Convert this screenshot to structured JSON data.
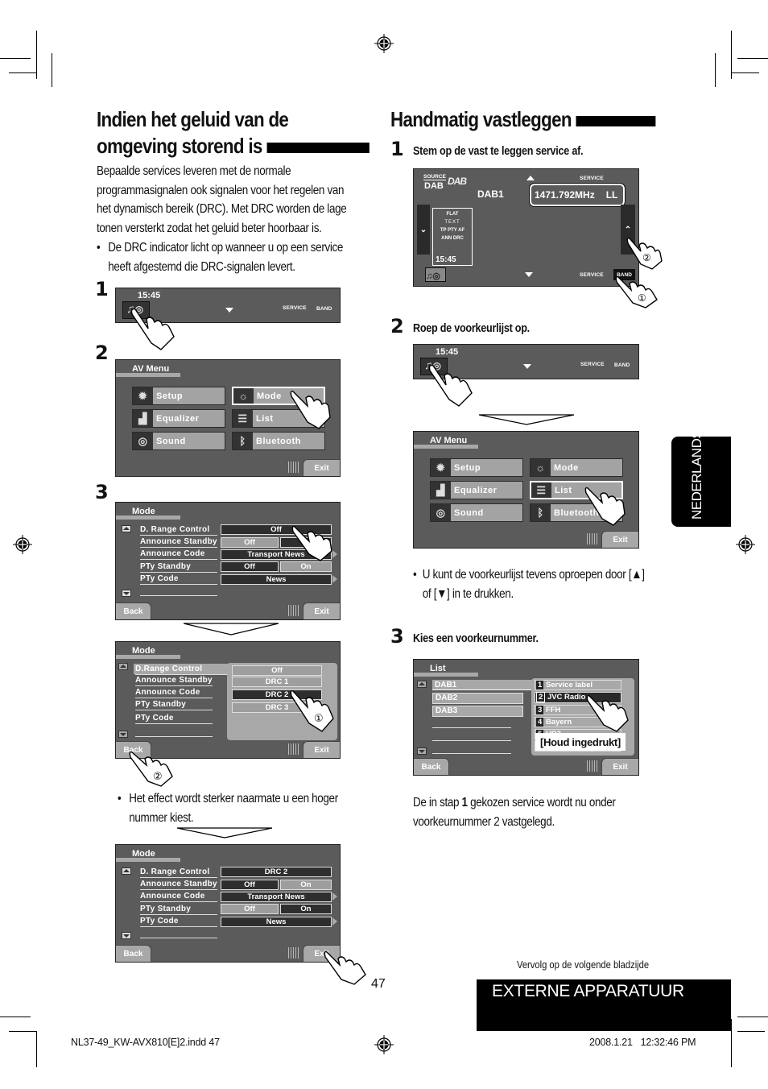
{
  "page": {
    "page_number": "47",
    "side_tab": "NEDERLANDS",
    "section_footer": "EXTERNE APPARATUUR",
    "continue_note": "Vervolg op de volgende bladzijde",
    "print_slug_left": "NL37-49_KW-AVX810[E]2.indd   47",
    "print_slug_right": "2008.1.21   12:32:46 PM"
  },
  "left": {
    "heading_line1": "Indien het geluid van de",
    "heading_line2": "omgeving storend is",
    "intro_lines": [
      "Bepaalde services leveren met de normale",
      "programmasignalen ook signalen voor het regelen van",
      "het dynamisch bereik (DRC). Met DRC worden de lage",
      "tonen versterkt zodat het geluid beter hoorbaar is."
    ],
    "bullet1_lines": [
      "De DRC indicator licht op wanneer u op een service",
      "heeft afgestemd die DRC-signalen levert."
    ],
    "bullet2_lines": [
      "Het effect wordt sterker naarmate u een hoger",
      "nummer kiest."
    ],
    "steps": [
      "1",
      "2",
      "3"
    ]
  },
  "right": {
    "heading": "Handmatig vastleggen",
    "step1": {
      "num": "1",
      "text": "Stem op de vast te leggen service af."
    },
    "step2": {
      "num": "2",
      "text": "Roep de voorkeurlijst op."
    },
    "step2_bullet_lines": [
      "U kunt de voorkeurlijst tevens oproepen door [▲]",
      "of [▼] in te drukken."
    ],
    "step3": {
      "num": "3",
      "text": "Kies een voorkeurnummer."
    },
    "result_line1_pre": "De in stap ",
    "result_line1_bold": "1",
    "result_line1_post": " gekozen service wordt nu onder",
    "result_line2": "voorkeurnummer 2 vastgelegd."
  },
  "strip": {
    "time": "15:45",
    "service": "SERVICE",
    "band": "BAND"
  },
  "av_menu": {
    "title": "AV Menu",
    "items": [
      "Setup",
      "Mode",
      "Equalizer",
      "List",
      "Sound",
      "Bluetooth"
    ],
    "icons": [
      "gear-icon",
      "mode-icon",
      "equalizer-icon",
      "list-icon",
      "sound-icon",
      "bluetooth-icon"
    ],
    "exit": "Exit"
  },
  "mode_menu": {
    "title": "Mode",
    "labels": [
      "D. Range Control",
      "Announce Standby",
      "Announce Code",
      "PTy Standby",
      "PTy Code"
    ],
    "labels_popup": [
      "D.Range Control",
      "Announce Standby",
      "Announce Code",
      "PTy Standby",
      "PTy Code"
    ],
    "off": "Off",
    "on": "On",
    "announce_code": "Transport News",
    "pty_code": "News",
    "drc_options": [
      "Off",
      "DRC 1",
      "DRC 2",
      "DRC 3"
    ],
    "drc_selected": "DRC 2",
    "back": "Back",
    "exit": "Exit"
  },
  "dab_screen": {
    "source_label": "SOURCE",
    "source_value": "DAB",
    "logo": "DAB",
    "band": "DAB1",
    "frequency": "1471.792MHz",
    "ll": "LL",
    "indicators": [
      "FLAT",
      "TEXT",
      "TP  PTY  AF",
      "ANN  DRC"
    ],
    "time": "15:45",
    "service": "SERVICE",
    "band_btn": "BAND"
  },
  "list_menu": {
    "title": "List",
    "bands": [
      "DAB1",
      "DAB2",
      "DAB3"
    ],
    "presets": [
      {
        "n": "1",
        "name": "Service label"
      },
      {
        "n": "2",
        "name": "JVC Radio"
      },
      {
        "n": "3",
        "name": "FFH"
      },
      {
        "n": "4",
        "name": "Bayern"
      },
      {
        "n": "5",
        "name": "HR3"
      }
    ],
    "hold_label": "[Houd ingedrukt]",
    "back": "Back",
    "exit": "Exit"
  },
  "callouts": {
    "one": "①",
    "two": "②"
  }
}
